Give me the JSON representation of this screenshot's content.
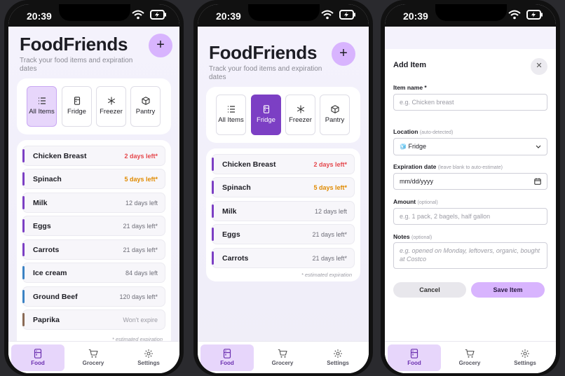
{
  "status": {
    "time": "20:39"
  },
  "app": {
    "title": "FoodFriends",
    "subtitle": "Track your food items and expiration dates",
    "add_label": "+",
    "filters": [
      "All Items",
      "Fridge",
      "Freezer",
      "Pantry"
    ],
    "footnote": "* estimated expiration"
  },
  "screen1": {
    "selected_filter": "All Items",
    "items": [
      {
        "name": "Chicken Breast",
        "status": "2 days left*",
        "status_color": "#e5484d",
        "bar_color": "#7c3fc4"
      },
      {
        "name": "Spinach",
        "status": "5 days left*",
        "status_color": "#e08a00",
        "bar_color": "#7c3fc4"
      },
      {
        "name": "Milk",
        "status": "12 days left",
        "status_color": "#6e6e78",
        "bar_color": "#7c3fc4"
      },
      {
        "name": "Eggs",
        "status": "21 days left*",
        "status_color": "#6e6e78",
        "bar_color": "#7c3fc4"
      },
      {
        "name": "Carrots",
        "status": "21 days left*",
        "status_color": "#6e6e78",
        "bar_color": "#7c3fc4"
      },
      {
        "name": "Ice cream",
        "status": "84 days left",
        "status_color": "#6e6e78",
        "bar_color": "#3b82c4"
      },
      {
        "name": "Ground Beef",
        "status": "120 days left*",
        "status_color": "#6e6e78",
        "bar_color": "#3b82c4"
      },
      {
        "name": "Paprika",
        "status": "Won't expire",
        "status_color": "#9b9ba4",
        "bar_color": "#8a6a55"
      }
    ]
  },
  "screen2": {
    "selected_filter": "Fridge",
    "items": [
      {
        "name": "Chicken Breast",
        "status": "2 days left*",
        "status_color": "#e5484d",
        "bar_color": "#7c3fc4"
      },
      {
        "name": "Spinach",
        "status": "5 days left*",
        "status_color": "#e08a00",
        "bar_color": "#7c3fc4"
      },
      {
        "name": "Milk",
        "status": "12 days left",
        "status_color": "#6e6e78",
        "bar_color": "#7c3fc4"
      },
      {
        "name": "Eggs",
        "status": "21 days left*",
        "status_color": "#6e6e78",
        "bar_color": "#7c3fc4"
      },
      {
        "name": "Carrots",
        "status": "21 days left*",
        "status_color": "#6e6e78",
        "bar_color": "#7c3fc4"
      }
    ]
  },
  "modal": {
    "title": "Add Item",
    "close_label": "✕",
    "name_label": "Item name *",
    "name_placeholder": "e.g. Chicken breast",
    "location_label": "Location",
    "location_hint": "(auto-detected)",
    "location_value": "Fridge",
    "location_icon": "🧊",
    "exp_label": "Expiration date",
    "exp_hint": "(leave blank to auto-estimate)",
    "exp_value": "mm/dd/yyyy",
    "amount_label": "Amount",
    "amount_hint": "(optional)",
    "amount_placeholder": "e.g. 1 pack, 2 bagels, half gallon",
    "notes_label": "Notes",
    "notes_hint": "(optional)",
    "notes_placeholder": "e.g. opened on Monday, leftovers, organic, bought at Costco",
    "cancel_label": "Cancel",
    "save_label": "Save Item"
  },
  "tabbar": [
    "Food",
    "Grocery",
    "Settings"
  ],
  "colors": {
    "accent": "#d8b4fe",
    "accent_dark": "#7c3fc4",
    "selected_light": "#e7d6fb"
  }
}
